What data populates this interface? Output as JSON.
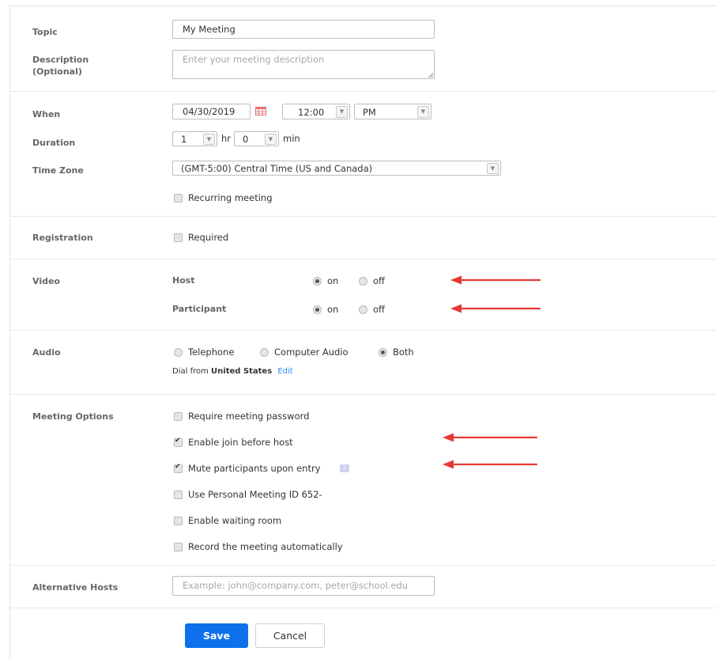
{
  "topic": {
    "label": "Topic",
    "value": "My Meeting"
  },
  "description": {
    "label_line1": "Description",
    "label_line2": "(Optional)",
    "placeholder": "Enter your meeting description"
  },
  "when": {
    "label": "When",
    "date": "04/30/2019",
    "time": "12:00",
    "ampm": "PM"
  },
  "duration": {
    "label": "Duration",
    "hours": "1",
    "hr_unit": "hr",
    "minutes": "0",
    "min_unit": "min"
  },
  "timezone": {
    "label": "Time Zone",
    "value": "(GMT-5:00) Central Time (US and Canada)"
  },
  "recurring": {
    "label": "Recurring meeting",
    "checked": false
  },
  "registration": {
    "label": "Registration",
    "option": "Required",
    "checked": false
  },
  "video": {
    "label": "Video",
    "host_label": "Host",
    "participant_label": "Participant",
    "on_label": "on",
    "off_label": "off",
    "host": "on",
    "participant": "on"
  },
  "audio": {
    "label": "Audio",
    "options": [
      "Telephone",
      "Computer Audio",
      "Both"
    ],
    "selected": "Both",
    "dial_prefix": "Dial from",
    "dial_country": "United States",
    "edit_label": "Edit"
  },
  "meeting_options": {
    "label": "Meeting Options",
    "items": [
      {
        "label": "Require meeting password",
        "checked": false
      },
      {
        "label": "Enable join before host",
        "checked": true
      },
      {
        "label": "Mute participants upon entry",
        "checked": true
      },
      {
        "label": "Use Personal Meeting ID 652-",
        "checked": false
      },
      {
        "label": "Enable waiting room",
        "checked": false
      },
      {
        "label": "Record the meeting automatically",
        "checked": false
      }
    ]
  },
  "alternative_hosts": {
    "label": "Alternative Hosts",
    "placeholder": "Example: john@company.com, peter@school.edu"
  },
  "actions": {
    "save_label": "Save",
    "cancel_label": "Cancel"
  },
  "colors": {
    "accent": "#0e71eb",
    "link": "#2d8cff",
    "annotation_arrow": "#e53935"
  }
}
